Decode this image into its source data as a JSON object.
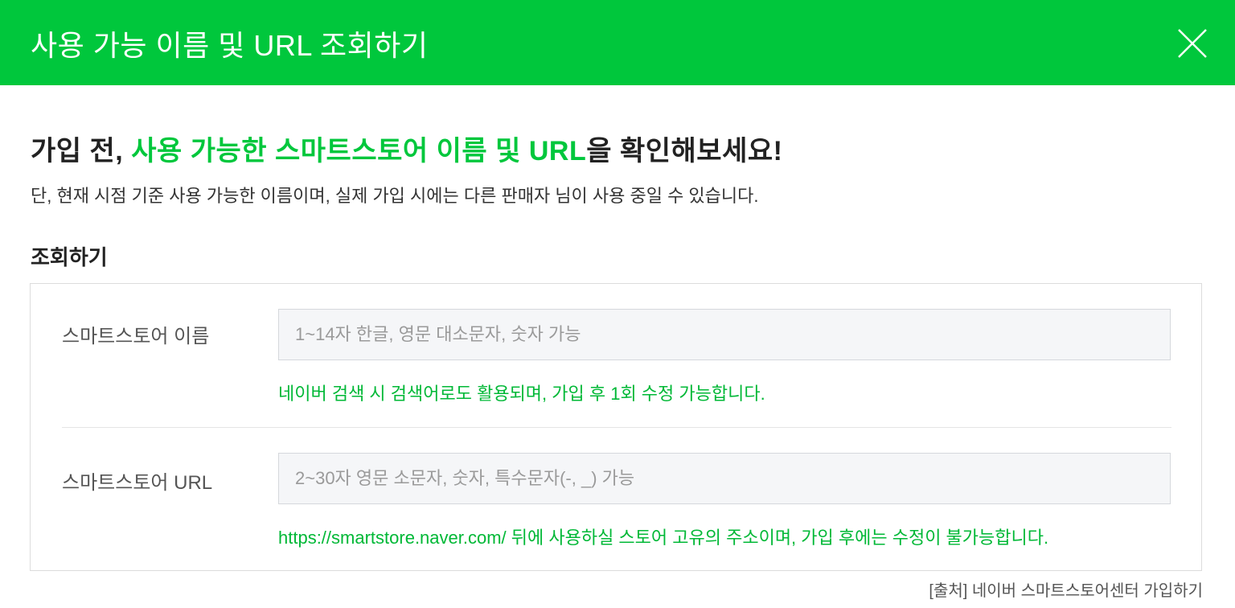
{
  "dialog": {
    "title": "사용 가능 이름 및 URL 조회하기",
    "close_icon": "close-icon"
  },
  "headline": {
    "prefix": "가입 전, ",
    "highlight": "사용 가능한 스마트스토어 이름 및 URL",
    "suffix": "을 확인해보세요!"
  },
  "subtext": "단, 현재 시점 기준 사용 가능한 이름이며, 실제 가입 시에는 다른 판매자 님이 사용 중일 수 있습니다.",
  "section_title": "조회하기",
  "form": {
    "store_name": {
      "label": "스마트스토어 이름",
      "value": "",
      "placeholder": "1~14자 한글, 영문 대소문자, 숫자 가능",
      "help": "네이버 검색 시 검색어로도 활용되며, 가입 후 1회 수정 가능합니다."
    },
    "store_url": {
      "label": "스마트스토어 URL",
      "value": "",
      "placeholder": "2~30자 영문 소문자, 숫자, 특수문자(-, _) 가능",
      "help": "https://smartstore.naver.com/ 뒤에 사용하실 스토어 고유의 주소이며, 가입 후에는 수정이 불가능합니다."
    }
  },
  "source_caption": "[출처] 네이버 스마트스토어센터 가입하기",
  "colors": {
    "brand_green": "#00c73c",
    "help_green": "#00b836"
  }
}
